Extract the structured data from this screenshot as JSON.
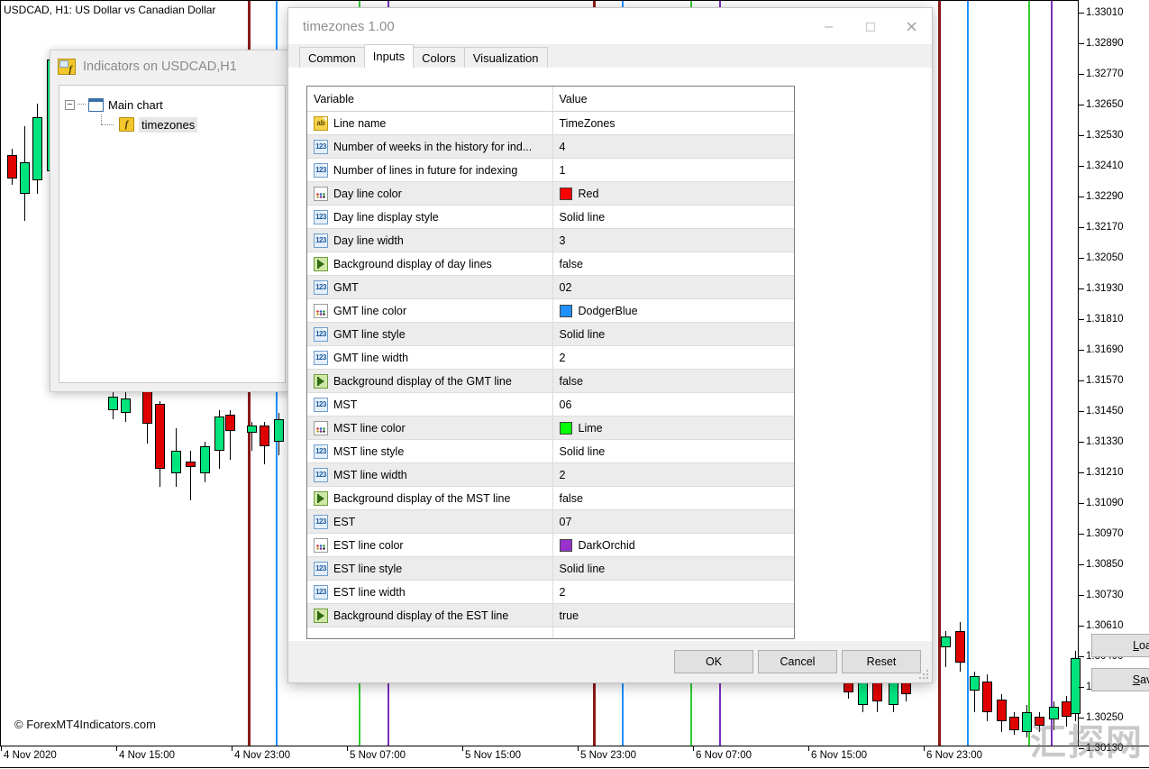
{
  "chart": {
    "symbol_label": "USDCAD, H1:  US Dollar vs Canadian Dollar",
    "copyright": "© ForexMT4Indicators.com",
    "watermark": "汇探网",
    "price_axis": [
      "1.33010",
      "1.32890",
      "1.32770",
      "1.32650",
      "1.32530",
      "1.32410",
      "1.32290",
      "1.32170",
      "1.32050",
      "1.31930",
      "1.31810",
      "1.31690",
      "1.31570",
      "1.31450",
      "1.31330",
      "1.31210",
      "1.31090",
      "1.30970",
      "1.30850",
      "1.30730",
      "1.30610",
      "1.30490",
      "1.30370",
      "1.30250",
      "1.30130"
    ],
    "time_axis": [
      "4 Nov 2020",
      "4 Nov 15:00",
      "4 Nov 23:00",
      "5 Nov 07:00",
      "5 Nov 15:00",
      "5 Nov 23:00",
      "6 Nov 07:00",
      "6 Nov 15:00",
      "6 Nov 23:00"
    ],
    "timezone_line_colors": {
      "day": "#8B1A1A",
      "gmt": "#1E90FF",
      "mst": "#32CD32",
      "est": "#7B2FBE"
    },
    "candle_colors": {
      "bull": "#00E47E",
      "bear": "#E00000",
      "outline": "#000000"
    }
  },
  "indicators_window": {
    "title": "Indicators on USDCAD,H1",
    "title_icon": "indicator-window-icon",
    "tree": {
      "root": {
        "label": "Main chart",
        "icon": "chart-window-icon",
        "expander": "−"
      },
      "child": {
        "label": "timezones",
        "icon": "fx-indicator-icon",
        "selected": true
      }
    }
  },
  "properties_dialog": {
    "title": "timezones 1.00",
    "window_buttons": [
      {
        "name": "minimize-button",
        "glyph": "minimize-icon"
      },
      {
        "name": "maximize-button",
        "glyph": "maximize-icon"
      },
      {
        "name": "close-button",
        "glyph": "close-icon"
      }
    ],
    "tabs": [
      {
        "label": "Common",
        "active": false
      },
      {
        "label": "Inputs",
        "active": true
      },
      {
        "label": "Colors",
        "active": false
      },
      {
        "label": "Visualization",
        "active": false
      }
    ],
    "table": {
      "headers": {
        "variable": "Variable",
        "value": "Value"
      },
      "rows": [
        {
          "icon": "string-param-icon",
          "type": "string",
          "variable": "Line name",
          "value": "TimeZones",
          "swatch": null
        },
        {
          "icon": "number-param-icon",
          "type": "number",
          "variable": "Number of weeks in the history for ind...",
          "value": "4",
          "swatch": null
        },
        {
          "icon": "number-param-icon",
          "type": "number",
          "variable": "Number of lines in future for indexing",
          "value": "1",
          "swatch": null
        },
        {
          "icon": "color-param-icon",
          "type": "color",
          "variable": "Day line color",
          "value": "Red",
          "swatch": "#FF0000"
        },
        {
          "icon": "number-param-icon",
          "type": "number",
          "variable": "Day line display style",
          "value": "Solid line",
          "swatch": null
        },
        {
          "icon": "number-param-icon",
          "type": "number",
          "variable": "Day line width",
          "value": "3",
          "swatch": null
        },
        {
          "icon": "bool-param-icon",
          "type": "bool",
          "variable": "Background display of day lines",
          "value": "false",
          "swatch": null
        },
        {
          "icon": "number-param-icon",
          "type": "number",
          "variable": "GMT",
          "value": "02",
          "swatch": null
        },
        {
          "icon": "color-param-icon",
          "type": "color",
          "variable": "GMT line color",
          "value": "DodgerBlue",
          "swatch": "#1E90FF"
        },
        {
          "icon": "number-param-icon",
          "type": "number",
          "variable": "GMT line style",
          "value": "Solid line",
          "swatch": null
        },
        {
          "icon": "number-param-icon",
          "type": "number",
          "variable": "GMT line width",
          "value": "2",
          "swatch": null
        },
        {
          "icon": "bool-param-icon",
          "type": "bool",
          "variable": "Background display of the GMT line",
          "value": "false",
          "swatch": null
        },
        {
          "icon": "number-param-icon",
          "type": "number",
          "variable": "MST",
          "value": "06",
          "swatch": null
        },
        {
          "icon": "color-param-icon",
          "type": "color",
          "variable": "MST line color",
          "value": "Lime",
          "swatch": "#00FF00"
        },
        {
          "icon": "number-param-icon",
          "type": "number",
          "variable": "MST line style",
          "value": "Solid line",
          "swatch": null
        },
        {
          "icon": "number-param-icon",
          "type": "number",
          "variable": "MST line width",
          "value": "2",
          "swatch": null
        },
        {
          "icon": "bool-param-icon",
          "type": "bool",
          "variable": "Background display of the MST line",
          "value": "false",
          "swatch": null
        },
        {
          "icon": "number-param-icon",
          "type": "number",
          "variable": "EST",
          "value": "07",
          "swatch": null
        },
        {
          "icon": "color-param-icon",
          "type": "color",
          "variable": "EST line color",
          "value": "DarkOrchid",
          "swatch": "#9932CC"
        },
        {
          "icon": "number-param-icon",
          "type": "number",
          "variable": "EST line style",
          "value": "Solid line",
          "swatch": null
        },
        {
          "icon": "number-param-icon",
          "type": "number",
          "variable": "EST line width",
          "value": "2",
          "swatch": null
        },
        {
          "icon": "bool-param-icon",
          "type": "bool",
          "variable": "Background display of the EST line",
          "value": "true",
          "swatch": null
        }
      ]
    },
    "side_buttons": [
      {
        "name": "load-button",
        "label": "Load",
        "mnemonic": "L"
      },
      {
        "name": "save-button",
        "label": "Save",
        "mnemonic": "S"
      }
    ],
    "footer_buttons": [
      {
        "name": "ok-button",
        "label": "OK"
      },
      {
        "name": "cancel-button",
        "label": "Cancel"
      },
      {
        "name": "reset-button",
        "label": "Reset"
      }
    ]
  }
}
